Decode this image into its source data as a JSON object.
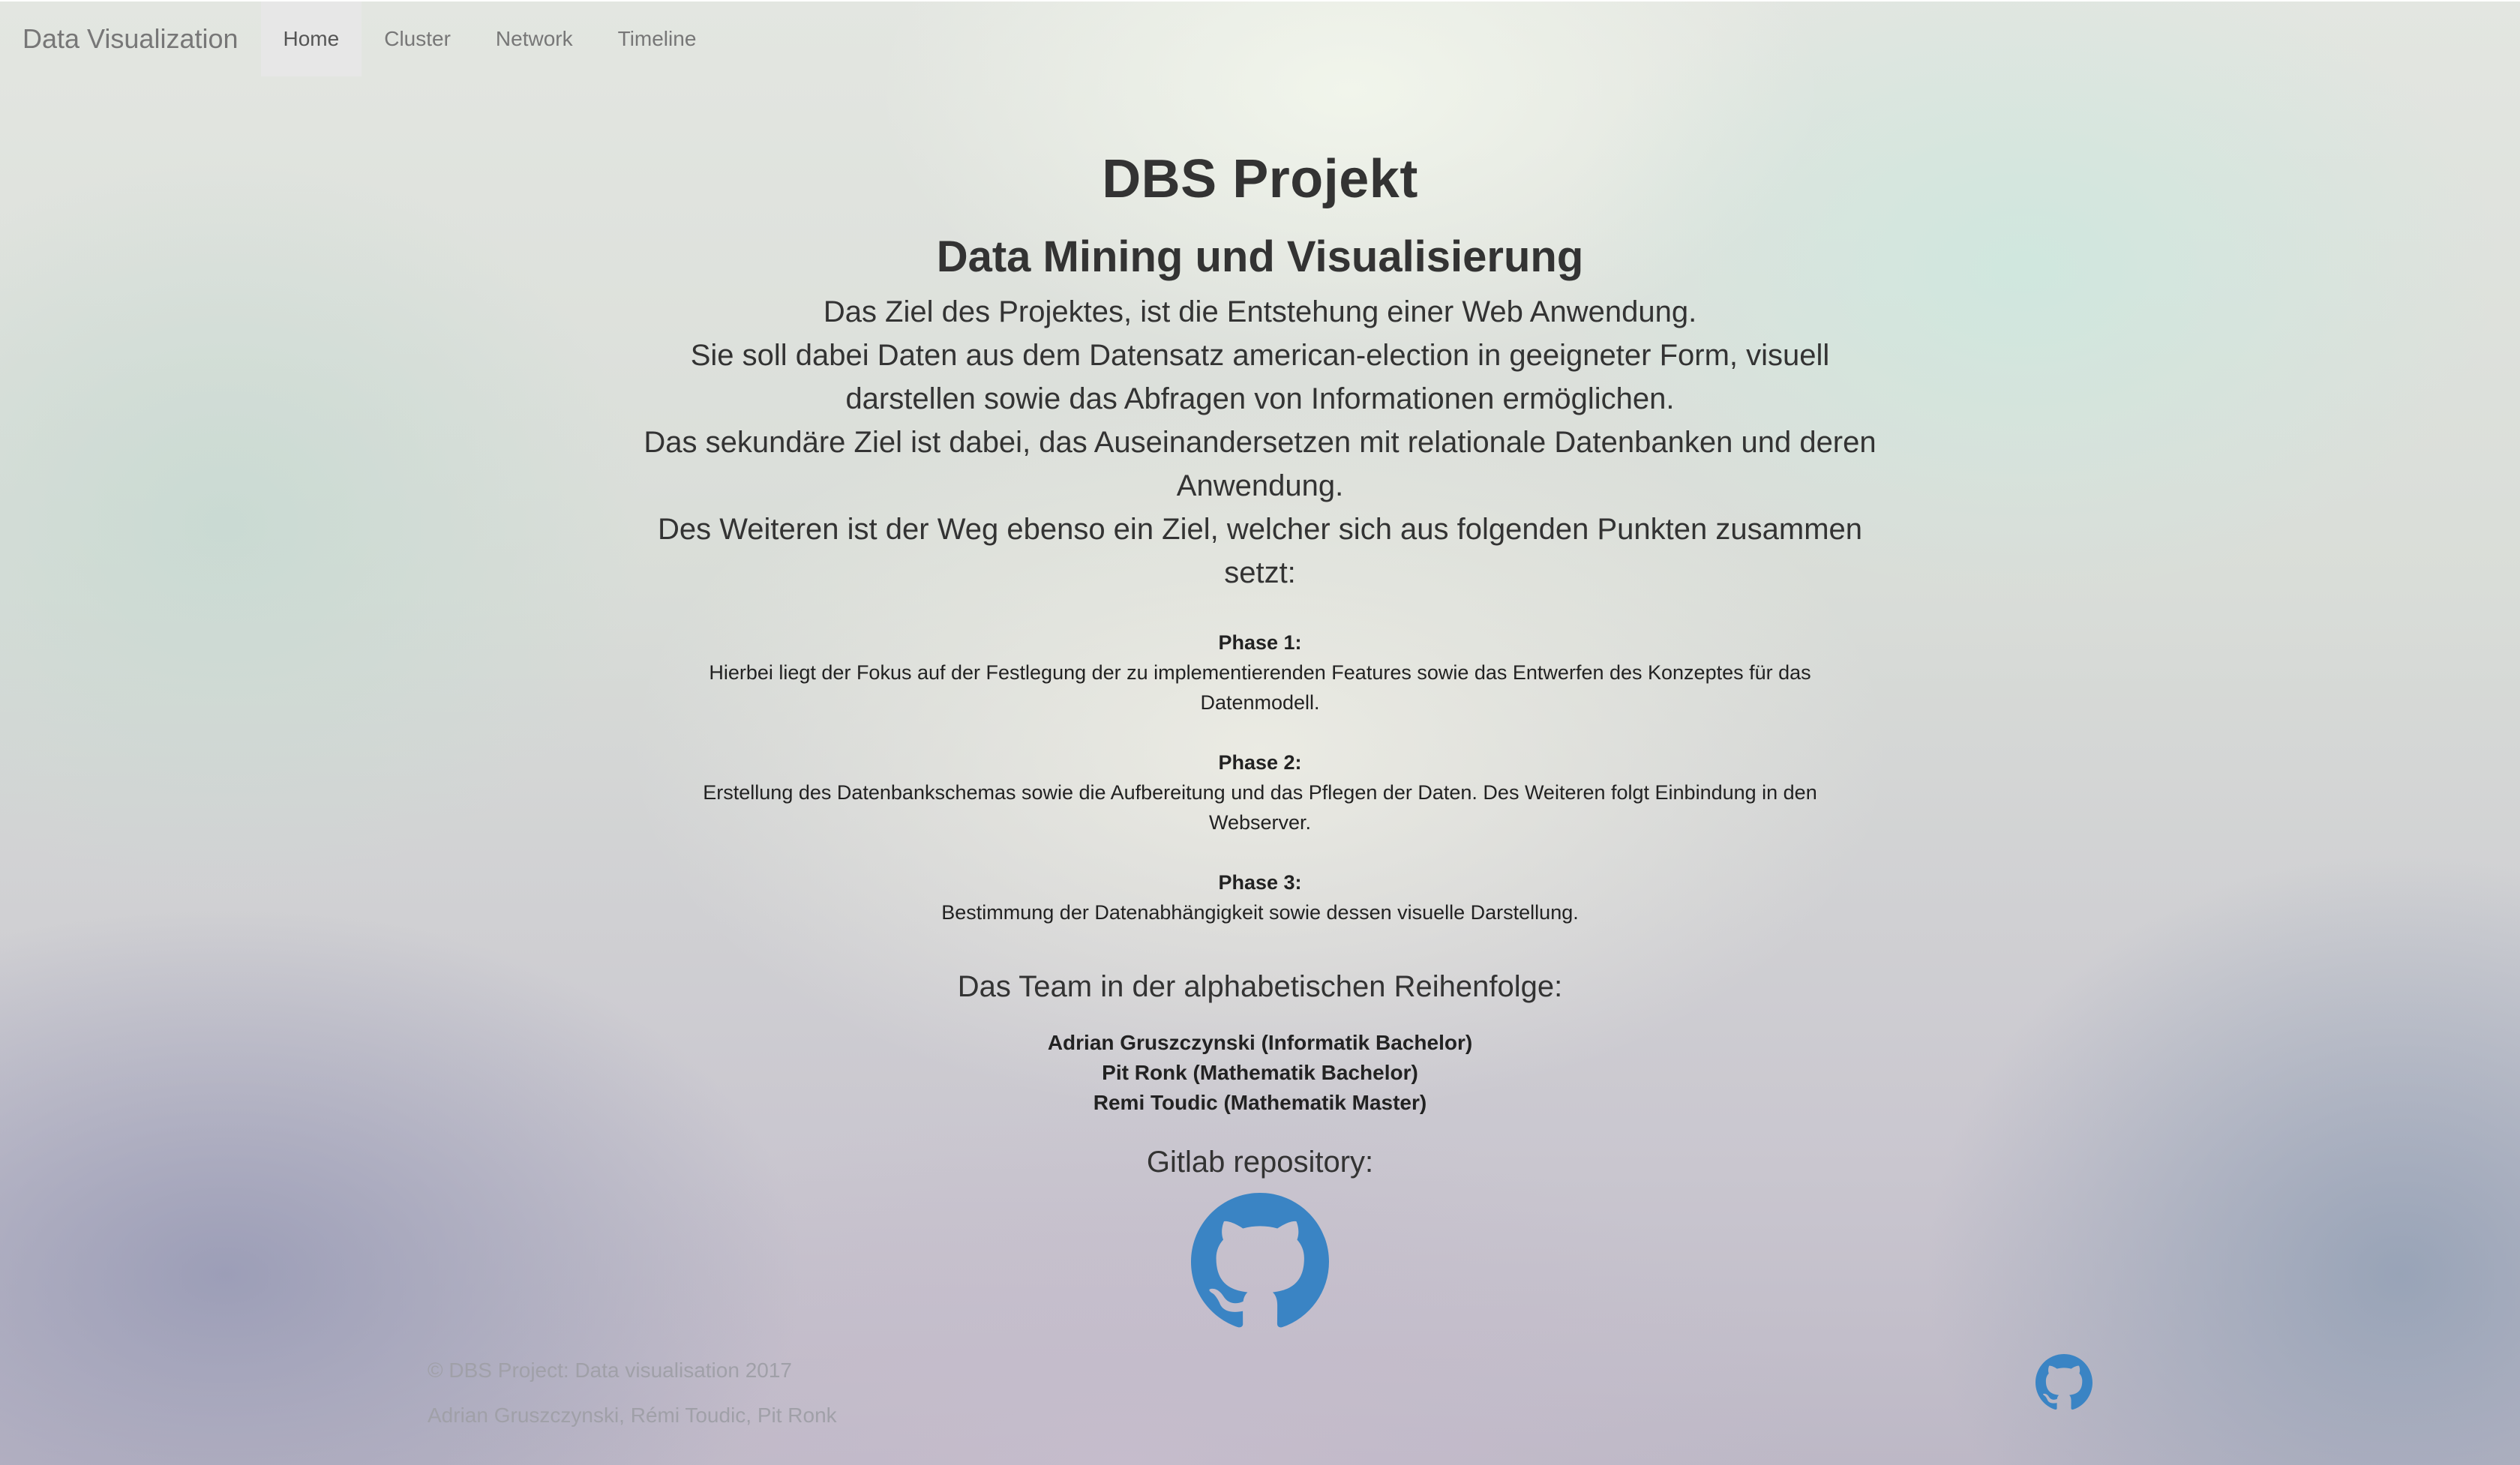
{
  "navbar": {
    "brand": "Data Visualization",
    "items": [
      {
        "label": "Home",
        "active": true
      },
      {
        "label": "Cluster",
        "active": false
      },
      {
        "label": "Network",
        "active": false
      },
      {
        "label": "Timeline",
        "active": false
      }
    ]
  },
  "main": {
    "title": "DBS Projekt",
    "subtitle": "Data Mining und Visualisierung",
    "intro": [
      "Das Ziel des Projektes, ist die Entstehung einer Web Anwendung.",
      "Sie soll dabei Daten aus dem Datensatz american-election in geeigneter Form, visuell",
      "darstellen sowie das Abfragen von Informationen ermöglichen.",
      "Das sekundäre Ziel ist dabei, das Auseinandersetzen mit relationale Datenbanken und deren",
      "Anwendung.",
      "Des Weiteren ist der Weg ebenso ein Ziel, welcher sich aus folgenden Punkten zusammen",
      "setzt:"
    ],
    "phases": [
      {
        "title": "Phase 1:",
        "text": [
          "Hierbei liegt der Fokus auf der Festlegung der zu implementierenden Features sowie das Entwerfen des Konzeptes für das",
          "Datenmodell."
        ]
      },
      {
        "title": "Phase 2:",
        "text": [
          "Erstellung des Datenbankschemas sowie die Aufbereitung und das Pflegen der Daten. Des Weiteren folgt Einbindung in den",
          "Webserver."
        ]
      },
      {
        "title": "Phase 3:",
        "text": [
          "Bestimmung der Datenabhängigkeit sowie dessen visuelle Darstellung."
        ]
      }
    ],
    "team_heading": "Das Team in der alphabetischen Reihenfolge:",
    "team": [
      "Adrian Gruszczynski (Informatik Bachelor)",
      "Pit Ronk (Mathematik Bachelor)",
      "Remi Toudic (Mathematik Master)"
    ],
    "gitlab_heading": "Gitlab repository:",
    "gitlab_icon": "github-icon",
    "gitlab_color": "#3a84c4"
  },
  "footer": {
    "copyright": "© DBS Project: Data visualisation 2017",
    "authors": "Adrian Gruszczynski, Rémi Toudic, Pit Ronk",
    "icon": "github-icon",
    "icon_color": "#3a84c4"
  }
}
